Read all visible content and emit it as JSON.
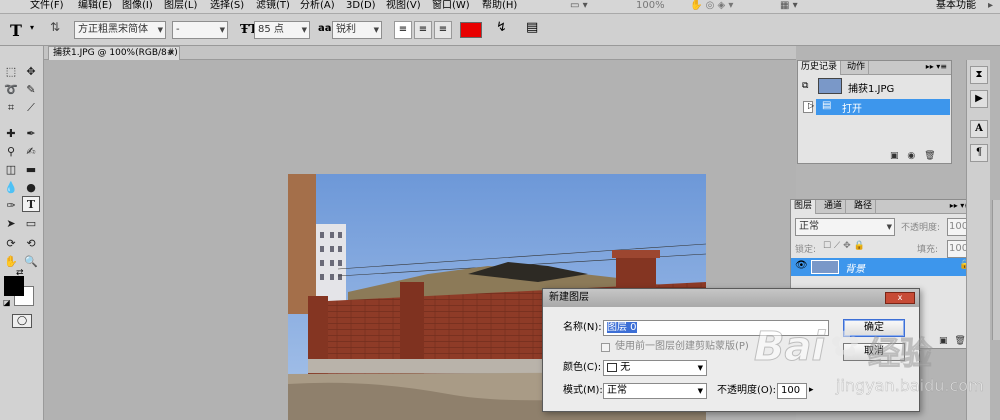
{
  "menu": [
    "文件(F)",
    "编辑(E)",
    "图像(I)",
    "图层(L)",
    "选择(S)",
    "滤镜(T)",
    "分析(A)",
    "3D(D)",
    "视图(V)",
    "窗口(W)",
    "帮助(H)"
  ],
  "menu_extra": {
    "zoom": "100%",
    "workspace": "基本功能"
  },
  "options": {
    "font_family": "方正粗黑宋简体",
    "font_style": "-",
    "font_size": "85 点",
    "antialias_label": "aa",
    "antialias": "锐利",
    "text_color": "#e80000"
  },
  "doc_tab": "捕获1.JPG @ 100%(RGB/8#)",
  "history": {
    "tabs": [
      "历史记录",
      "动作"
    ],
    "snapshot": "捕获1.JPG",
    "items": [
      "打开"
    ]
  },
  "layers": {
    "tabs": [
      "图层",
      "通道",
      "路径"
    ],
    "blend_mode": "正常",
    "opacity_label": "不透明度:",
    "opacity": "100%",
    "lock_label": "锁定:",
    "fill_label": "填充:",
    "fill": "100%",
    "layer_name": "背景"
  },
  "dialog": {
    "title": "新建图层",
    "name_label": "名称(N):",
    "name_value": "图层 0",
    "clip_label": "使用前一图层创建剪贴蒙版(P)",
    "color_label": "颜色(C):",
    "color_value": "无",
    "mode_label": "模式(M):",
    "mode_value": "正常",
    "opacity_label": "不透明度(O):",
    "opacity_value": "100",
    "ok": "确定",
    "cancel": "取消",
    "close": "x"
  },
  "watermark": {
    "brand": "Bai",
    "brand2": "经验",
    "url": "jingyan.baidu.com"
  },
  "colors": {
    "accent": "#3d96ec",
    "fg": "#000000",
    "bg": "#ffffff"
  }
}
